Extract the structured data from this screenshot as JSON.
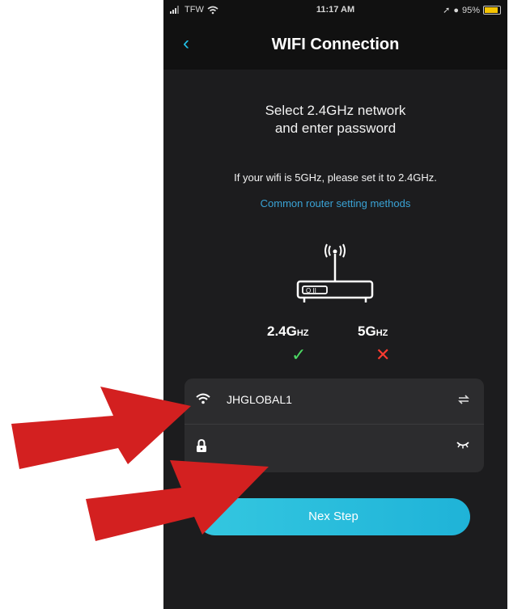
{
  "status_bar": {
    "carrier": "TFW",
    "time": "11:17 AM",
    "battery": "95%"
  },
  "nav": {
    "title": "WIFI Connection"
  },
  "content": {
    "heading_line1": "Select 2.4GHz network",
    "heading_line2": "and enter password",
    "note": "If your wifi is 5GHz,  please set it to 2.4GHz.",
    "link": "Common router setting methods",
    "band_supported": {
      "value": "2.4G",
      "unit": "HZ"
    },
    "band_unsupported": {
      "value": "5G",
      "unit": "HZ"
    }
  },
  "form": {
    "ssid": "JHGLOBAL1",
    "password": ""
  },
  "button": {
    "label": "Nex Step"
  },
  "colors": {
    "accent": "#22c2e8",
    "ok": "#4cd964",
    "error": "#ff3b30",
    "arrow": "#d32020"
  }
}
